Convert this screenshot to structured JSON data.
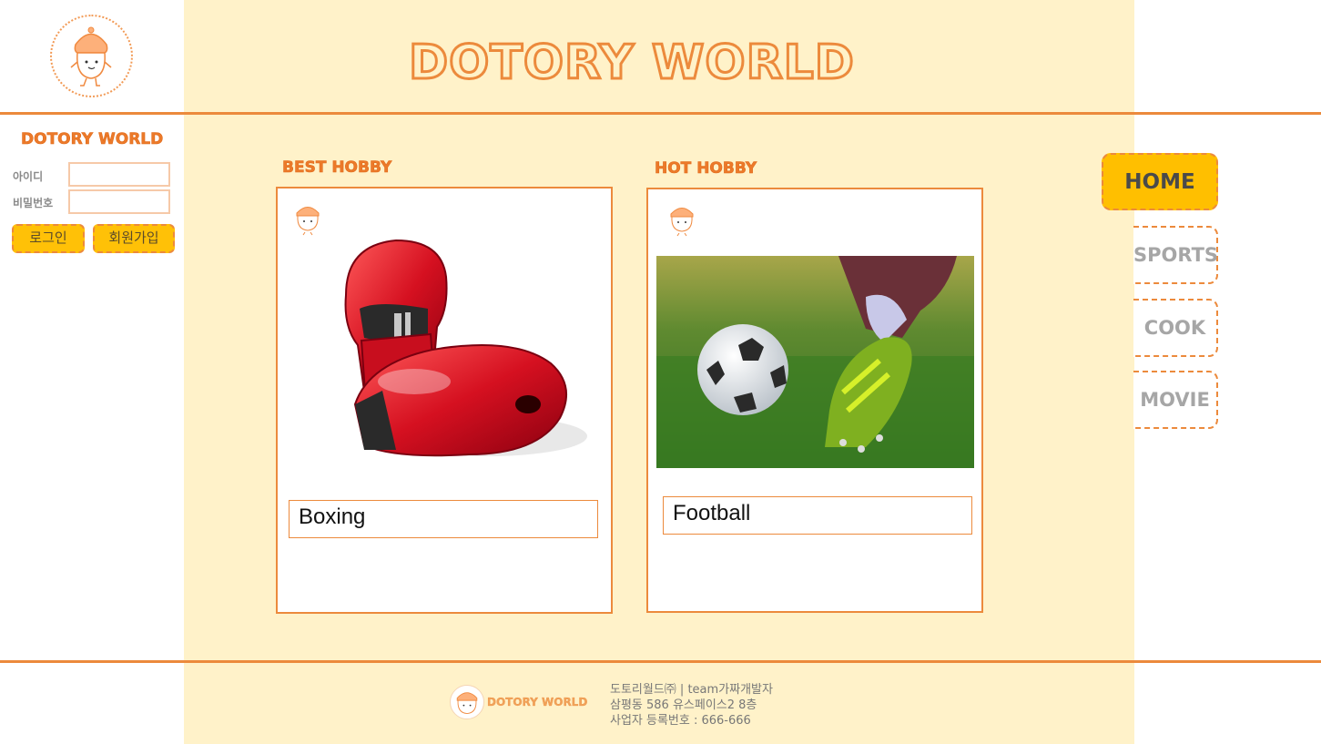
{
  "header": {
    "title": "DOTORY WORLD"
  },
  "sidebar": {
    "brand": "DOTORY WORLD",
    "id_label": "아이디",
    "pw_label": "비밀번호",
    "id_value": "",
    "pw_value": "",
    "login_button": "로그인",
    "signup_button": "회원가입"
  },
  "sections": {
    "best": {
      "title": "BEST HOBBY",
      "label": "Boxing"
    },
    "hot": {
      "title": "HOT HOBBY",
      "label": "Football"
    }
  },
  "nav": {
    "items": [
      "HOME",
      "SPORTS",
      "COOK",
      "MOVIE"
    ],
    "active": "HOME"
  },
  "footer": {
    "brand": "DOTORY WORLD",
    "line1": "도토리월드㈜ | team가짜개발자",
    "line2": "삼평동 586 유스페이스2 8층",
    "line3": "사업자 등록번호 : 666-666"
  },
  "colors": {
    "accent": "#ec8a3c",
    "panel": "#fff2c9",
    "button": "#ffc107"
  },
  "icons": {
    "mascot": "acorn-mascot-icon",
    "gloves": "boxing-gloves-image",
    "football": "football-photo-image"
  }
}
